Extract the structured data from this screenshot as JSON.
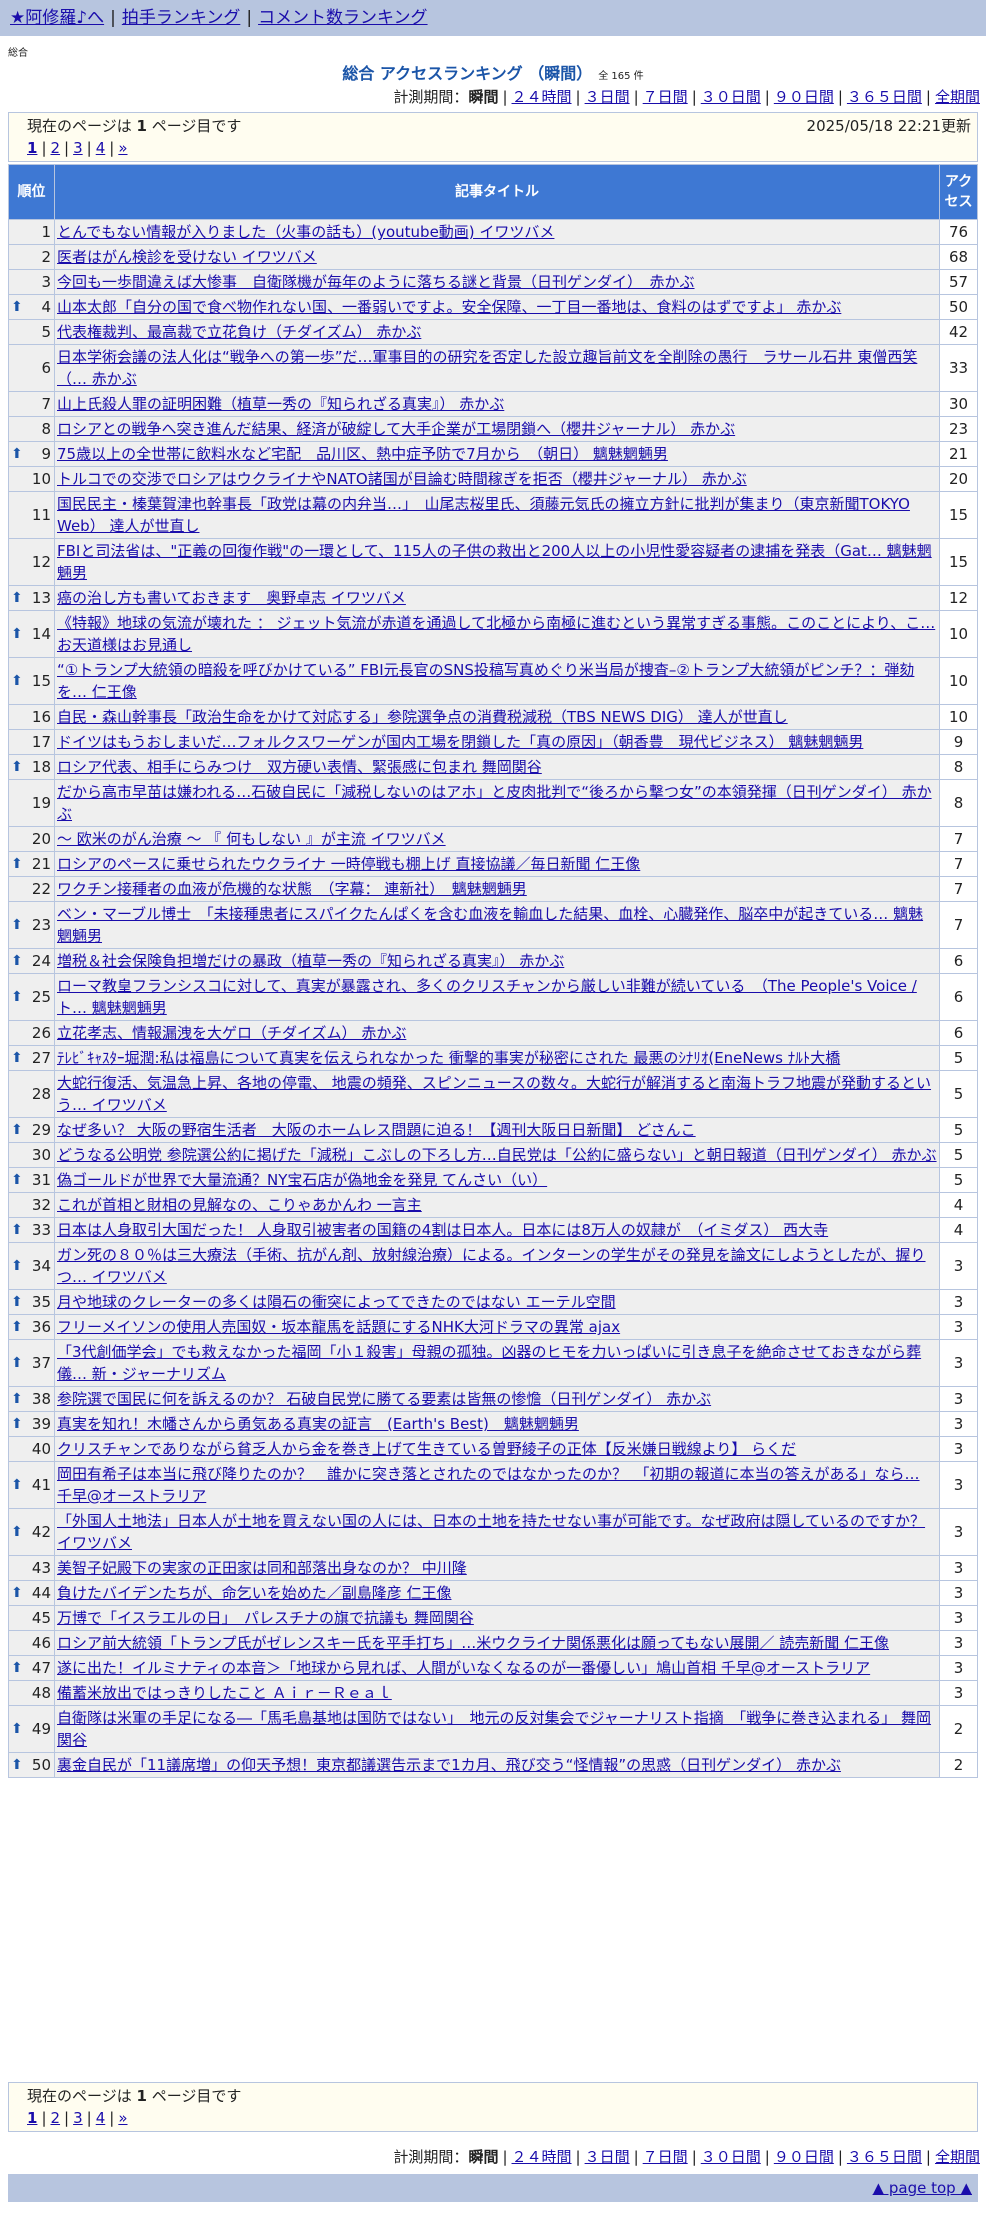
{
  "nav": {
    "home": "★阿修羅♪へ",
    "clap": "拍手ランキング",
    "comment": "コメント数ランキング"
  },
  "label_small": "総合",
  "title": "総合 アクセスランキング （瞬間）",
  "count": "全 165 件",
  "period": {
    "label": "計測期間：",
    "current": "瞬間",
    "links": [
      "２４時間",
      "３日間",
      "７日間",
      "３０日間",
      "９０日間",
      "３６５日間",
      "全期間"
    ]
  },
  "page_info": {
    "before": "現在のページは ",
    "num": "1",
    "after": " ページ目です",
    "updated": "2025/05/18 22:21更新",
    "pages": [
      "1",
      "2",
      "3",
      "4"
    ],
    "next": "»"
  },
  "headers": {
    "rank": "順位",
    "title": "記事タイトル",
    "access": "アクセス"
  },
  "arrow_icon": "up-arrow-icon",
  "rows": [
    {
      "rank": "1",
      "up": false,
      "title": "とんでもない情報が入りました（火事の話も）(youtube動画) イワツバメ",
      "access": "76"
    },
    {
      "rank": "2",
      "up": false,
      "title": "医者はがん検診を受けない イワツバメ",
      "access": "68"
    },
    {
      "rank": "3",
      "up": false,
      "title": "今回も一歩間違えば大惨事　自衛隊機が毎年のように落ちる謎と背景（日刊ゲンダイ）　赤かぶ",
      "access": "57"
    },
    {
      "rank": "4",
      "up": true,
      "title": "山本太郎「自分の国で食べ物作れない国、一番弱いですよ。安全保障、一丁目一番地は、食料のはずですよ」 赤かぶ",
      "access": "50"
    },
    {
      "rank": "5",
      "up": false,
      "title": "代表権裁判、最高裁で立花負け（チダイズム） 赤かぶ",
      "access": "42"
    },
    {
      "rank": "6",
      "up": false,
      "title": "日本学術会議の法人化は“戦争への第一歩”だ…軍事目的の研究を否定した設立趣旨前文を全削除の愚行　ラサール石井 東僧西笑（… 赤かぶ",
      "access": "33"
    },
    {
      "rank": "7",
      "up": false,
      "title": "山上氏殺人罪の証明困難（植草一秀の『知られざる真実』） 赤かぶ",
      "access": "30"
    },
    {
      "rank": "8",
      "up": false,
      "title": "ロシアとの戦争へ突き進んだ結果、経済が破綻して大手企業が工場閉鎖へ（櫻井ジャーナル） 赤かぶ",
      "access": "23"
    },
    {
      "rank": "9",
      "up": true,
      "title": "75歳以上の全世帯に飲料水など宅配　品川区、熱中症予防で7月から　（朝日） 魑魅魍魎男",
      "access": "21"
    },
    {
      "rank": "10",
      "up": false,
      "title": "トルコでの交渉でロシアはウクライナやNATO諸国が目論む時間稼ぎを拒否（櫻井ジャーナル） 赤かぶ",
      "access": "20"
    },
    {
      "rank": "11",
      "up": false,
      "title": "国民民主・榛葉賀津也幹事長「政党は幕の内弁当…」　山尾志桜里氏、須藤元気氏の擁立方針に批判が集まり（東京新聞TOKYO Web） 達人が世直し",
      "access": "15"
    },
    {
      "rank": "12",
      "up": false,
      "title": "FBIと司法省は、\"正義の回復作戦\"の一環として、115人の子供の救出と200人以上の小児性愛容疑者の逮捕を発表（Gat… 魑魅魍魎男",
      "access": "15"
    },
    {
      "rank": "13",
      "up": true,
      "title": "癌の治し方も書いておきます　奥野卓志 イワツバメ",
      "access": "12"
    },
    {
      "rank": "14",
      "up": true,
      "title": "《特報》地球の気流が壊れた ： ジェット気流が赤道を通過して北極から南極に進むという異常すぎる事態。このことにより、こ… お天道様はお見通し",
      "access": "10"
    },
    {
      "rank": "15",
      "up": true,
      "title": "“①トランプ大統領の暗殺を呼びかけている” FBI元長官のSNS投稿写真めぐり米当局が捜査–②トランプ大統領がピンチ？：弾劾を… 仁王像",
      "access": "10"
    },
    {
      "rank": "16",
      "up": false,
      "title": "自民・森山幹事長「政治生命をかけて対応する」参院選争点の消費税減税（TBS NEWS DIG） 達人が世直し",
      "access": "10"
    },
    {
      "rank": "17",
      "up": false,
      "title": "ドイツはもうおしまいだ…フォルクスワーゲンが国内工場を閉鎖した「真の原因」（朝香豊　現代ビジネス） 魑魅魍魎男",
      "access": "9"
    },
    {
      "rank": "18",
      "up": true,
      "title": "ロシア代表、相手にらみつけ　双方硬い表情、緊張感に包まれ 舞岡関谷",
      "access": "8"
    },
    {
      "rank": "19",
      "up": false,
      "title": "だから高市早苗は嫌われる…石破自民に「減税しないのはアホ」と皮肉批判で“後ろから撃つ女”の本領発揮（日刊ゲンダイ） 赤かぶ",
      "access": "8"
    },
    {
      "rank": "20",
      "up": false,
      "title": "～ 欧米のがん治療 ～ 『 何もしない 』が主流 イワツバメ",
      "access": "7"
    },
    {
      "rank": "21",
      "up": true,
      "title": "ロシアのペースに乗せられたウクライナ 一時停戦も棚上げ 直接協議／毎日新聞 仁王像",
      "access": "7"
    },
    {
      "rank": "22",
      "up": false,
      "title": "ワクチン接種者の血液が危機的な状態　（字幕： 連新社）　魑魅魍魎男",
      "access": "7"
    },
    {
      "rank": "23",
      "up": true,
      "title": "ベン・マーブル博士　「未接種患者にスパイクたんぱくを含む血液を輸血した結果、血栓、心臓発作、脳卒中が起きている… 魑魅魍魎男",
      "access": "7"
    },
    {
      "rank": "24",
      "up": true,
      "title": "増税＆社会保険負担増だけの暴政（植草一秀の『知られざる真実』） 赤かぶ",
      "access": "6"
    },
    {
      "rank": "25",
      "up": true,
      "title": "ローマ教皇フランシスコに対して、真実が暴露され、多くのクリスチャンから厳しい非難が続いている　（The People's Voice / ト… 魑魅魍魎男",
      "access": "6"
    },
    {
      "rank": "26",
      "up": false,
      "title": "立花孝志、情報漏洩を大ゲロ（チダイズム） 赤かぶ",
      "access": "6"
    },
    {
      "rank": "27",
      "up": true,
      "title": "ﾃﾚﾋﾞｷｬｽﾀｰ堀潤:私は福島について真実を伝えられなかった 衝撃的事実が秘密にされた 最悪のｼﾅﾘｵ(EneNews ﾅﾙﾄ大橋",
      "access": "5"
    },
    {
      "rank": "28",
      "up": false,
      "title": "大蛇行復活、気温急上昇、各地の停電、 地震の頻発、スピンニュースの数々。大蛇行が解消すると南海トラフ地震が発動するという… イワツバメ",
      "access": "5"
    },
    {
      "rank": "29",
      "up": true,
      "title": "なぜ多い？ 大阪の野宿生活者　大阪のホームレス問題に迫る！【週刊大阪日日新聞】 どさんこ",
      "access": "5"
    },
    {
      "rank": "30",
      "up": false,
      "title": "どうなる公明党 参院選公約に掲げた「減税」こぶしの下ろし方…自民党は「公約に盛らない」と朝日報道（日刊ゲンダイ） 赤かぶ",
      "access": "5"
    },
    {
      "rank": "31",
      "up": true,
      "title": "偽ゴールドが世界で大量流通？NY宝石店が偽地金を発見 てんさい（い）",
      "access": "5"
    },
    {
      "rank": "32",
      "up": false,
      "title": "これが首相と財相の見解なの、こりゃあかんわ 一言主",
      "access": "4"
    },
    {
      "rank": "33",
      "up": true,
      "title": "日本は人身取引大国だった！ 人身取引被害者の国籍の4割は日本人。日本には8万人の奴隷が　（イミダス） 西大寺",
      "access": "4"
    },
    {
      "rank": "34",
      "up": true,
      "title": "ガン死の８０％は三大療法（手術、抗がん剤、放射線治療）による。インターンの学生がその発見を論文にしようとしたが、握りつ… イワツバメ",
      "access": "3"
    },
    {
      "rank": "35",
      "up": true,
      "title": "月や地球のクレーターの多くは隕石の衝突によってできたのではない エーテル空間",
      "access": "3"
    },
    {
      "rank": "36",
      "up": true,
      "title": "フリーメイソンの使用人売国奴・坂本龍馬を話題にするNHK大河ドラマの異常 ajax",
      "access": "3"
    },
    {
      "rank": "37",
      "up": true,
      "title": "「3代創価学会」でも救えなかった福岡「小１殺害」母親の孤独。凶器のヒモを力いっぱいに引き息子を絶命させておきながら葬儀… 新・ジャーナリズム",
      "access": "3"
    },
    {
      "rank": "38",
      "up": true,
      "title": "参院選で国民に何を訴えるのか？ 石破自民党に勝てる要素は皆無の惨憺（日刊ゲンダイ） 赤かぶ",
      "access": "3"
    },
    {
      "rank": "39",
      "up": true,
      "title": "真実を知れ！木幡さんから勇気ある真実の証言　(Earth's Best)　魑魅魍魎男",
      "access": "3"
    },
    {
      "rank": "40",
      "up": false,
      "title": "クリスチャンでありながら貧乏人から金を巻き上げて生きている曽野綾子の正体【反米嫌日戦線より】 らくだ",
      "access": "3"
    },
    {
      "rank": "41",
      "up": true,
      "title": "岡田有希子は本当に飛び降りたのか？　誰かに突き落とされたのではなかったのか？　「初期の報道に本当の答えがある」なら… 千早@オーストラリア",
      "access": "3"
    },
    {
      "rank": "42",
      "up": true,
      "title": "「外国人土地法」日本人が土地を買えない国の人には、日本の土地を持たせない事が可能です。なぜ政府は隠しているのですか？ イワツバメ",
      "access": "3"
    },
    {
      "rank": "43",
      "up": false,
      "title": "美智子妃殿下の実家の正田家は同和部落出身なのか？ 中川隆",
      "access": "3"
    },
    {
      "rank": "44",
      "up": true,
      "title": "負けたバイデンたちが、命乞いを始めた／副島隆彦 仁王像",
      "access": "3"
    },
    {
      "rank": "45",
      "up": false,
      "title": "万博で「イスラエルの日」　パレスチナの旗で抗議も 舞岡関谷",
      "access": "3"
    },
    {
      "rank": "46",
      "up": false,
      "title": "ロシア前大統領「トランプ氏がゼレンスキー氏を平手打ち」…米ウクライナ関係悪化は願ってもない展開／ 読売新聞 仁王像",
      "access": "3"
    },
    {
      "rank": "47",
      "up": true,
      "title": "遂に出た！イルミナティの本音＞「地球から見れば、人間がいなくなるのが一番優しい」鳩山首相 千早@オーストラリア",
      "access": "3"
    },
    {
      "rank": "48",
      "up": false,
      "title": "備蓄米放出ではっきりしたこと Ａｉｒ－Ｒｅａｌ",
      "access": "3"
    },
    {
      "rank": "49",
      "up": true,
      "title": "自衛隊は米軍の手足になる―「馬毛島基地は国防ではない」　地元の反対集会でジャーナリスト指摘　「戦争に巻き込まれる」 舞岡関谷",
      "access": "2"
    },
    {
      "rank": "50",
      "up": true,
      "title": "裏金自民が「11議席増」の仰天予想！東京都議選告示まで1カ月、飛び交う“怪情報”の思惑（日刊ゲンダイ） 赤かぶ",
      "access": "2"
    }
  ],
  "footer": {
    "page_top": "▲ page top ▲"
  }
}
